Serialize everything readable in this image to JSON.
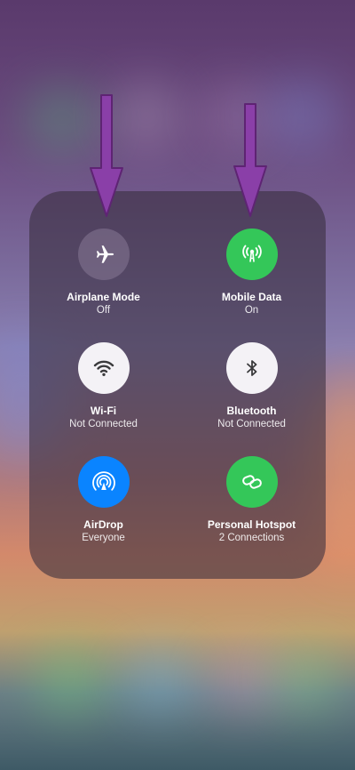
{
  "controls": [
    {
      "label": "Airplane Mode",
      "status": "Off",
      "icon": "airplane-icon"
    },
    {
      "label": "Mobile Data",
      "status": "On",
      "icon": "antenna-icon"
    },
    {
      "label": "Wi-Fi",
      "status": "Not Connected",
      "icon": "wifi-icon"
    },
    {
      "label": "Bluetooth",
      "status": "Not Connected",
      "icon": "bluetooth-icon"
    },
    {
      "label": "AirDrop",
      "status": "Everyone",
      "icon": "airdrop-icon"
    },
    {
      "label": "Personal Hotspot",
      "status": "2 Connections",
      "icon": "hotspot-icon"
    }
  ],
  "colors": {
    "mobile_data_on": "#34c759",
    "airdrop_on": "#0a84ff",
    "hotspot_on": "#34c759",
    "arrow": "#8a3fa8"
  }
}
